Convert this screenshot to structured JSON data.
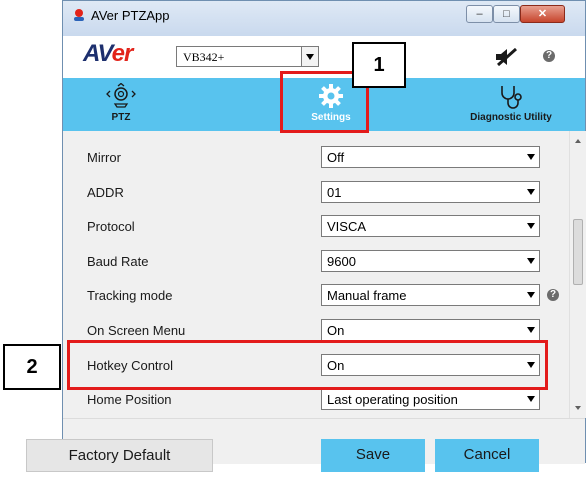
{
  "window": {
    "title": "AVer PTZApp"
  },
  "titlebar": {
    "min_glyph": "–",
    "max_glyph": "□",
    "close_glyph": "✕"
  },
  "toolbar": {
    "logo_left": "AV",
    "logo_right": "er",
    "model": "VB342+",
    "help_glyph": "?"
  },
  "tabs": [
    {
      "label": "PTZ",
      "icon": "camera-pan-icon"
    },
    {
      "label": "Settings",
      "icon": "gear-icon",
      "active": true
    },
    {
      "label": "Diagnostic Utility",
      "icon": "stethoscope-icon"
    }
  ],
  "settings": [
    {
      "label": "Mirror",
      "value": "Off"
    },
    {
      "label": "ADDR",
      "value": "01"
    },
    {
      "label": "Protocol",
      "value": "VISCA"
    },
    {
      "label": "Baud Rate",
      "value": "9600"
    },
    {
      "label": "Tracking mode",
      "value": "Manual frame",
      "help": "?"
    },
    {
      "label": "On Screen Menu",
      "value": "On"
    },
    {
      "label": "Hotkey Control",
      "value": "On"
    },
    {
      "label": "Home Position",
      "value": "Last operating position"
    }
  ],
  "buttons": {
    "factory_default": "Factory Default",
    "save": "Save",
    "cancel": "Cancel"
  },
  "annotations": {
    "callout_1": "1",
    "callout_2": "2"
  },
  "colors": {
    "accent": "#58c3ee",
    "highlight": "#e31b1b",
    "brand_blue": "#1d2f6e",
    "brand_red": "#e2231a"
  }
}
